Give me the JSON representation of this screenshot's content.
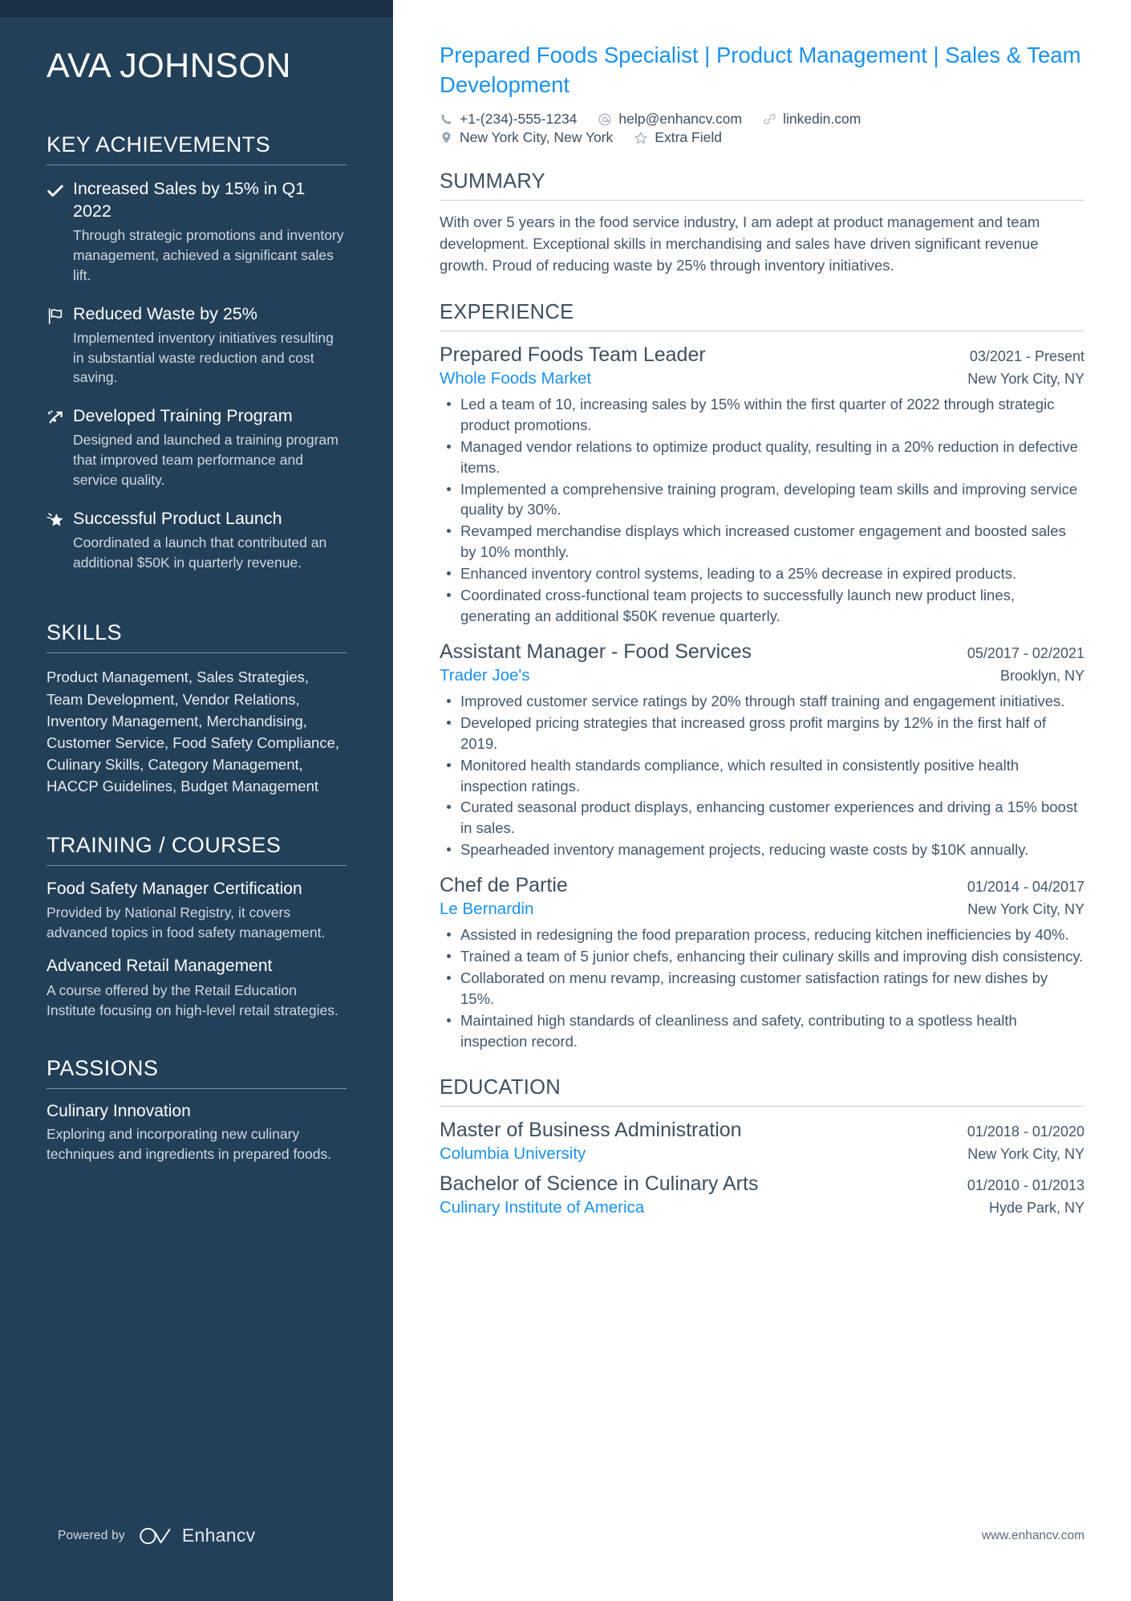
{
  "sidebar": {
    "name": "AVA JOHNSON",
    "key_achievements": {
      "heading": "KEY ACHIEVEMENTS",
      "items": [
        {
          "icon": "check-icon",
          "title": "Increased Sales by 15% in Q1 2022",
          "description": "Through strategic promotions and inventory management, achieved a significant sales lift."
        },
        {
          "icon": "flag-icon",
          "title": "Reduced Waste by 25%",
          "description": "Implemented inventory initiatives resulting in substantial waste reduction and cost saving."
        },
        {
          "icon": "rocket-arrow-icon",
          "title": "Developed Training Program",
          "description": "Designed and launched a training program that improved team performance and service quality."
        },
        {
          "icon": "shooting-star-icon",
          "title": "Successful Product Launch",
          "description": "Coordinated a launch that contributed an additional $50K in quarterly revenue."
        }
      ]
    },
    "skills": {
      "heading": "SKILLS",
      "text": "Product Management, Sales Strategies, Team Development, Vendor Relations, Inventory Management, Merchandising, Customer Service, Food Safety Compliance, Culinary Skills, Category Management, HACCP Guidelines, Budget Management"
    },
    "training": {
      "heading": "TRAINING / COURSES",
      "items": [
        {
          "title": "Food Safety Manager Certification",
          "description": "Provided by National Registry, it covers advanced topics in food safety management."
        },
        {
          "title": "Advanced Retail Management",
          "description": "A course offered by the Retail Education Institute focusing on high-level retail strategies."
        }
      ]
    },
    "passions": {
      "heading": "PASSIONS",
      "items": [
        {
          "title": "Culinary Innovation",
          "description": "Exploring and incorporating new culinary techniques and ingredients in prepared foods."
        }
      ]
    },
    "powered_by": {
      "label": "Powered by",
      "brand": "Enhancv"
    }
  },
  "main": {
    "headline": "Prepared Foods Specialist | Product Management | Sales & Team Development",
    "contacts": [
      {
        "icon": "phone-icon",
        "value": "+1-(234)-555-1234"
      },
      {
        "icon": "at-icon",
        "value": "help@enhancv.com"
      },
      {
        "icon": "link-icon",
        "value": "linkedin.com"
      },
      {
        "icon": "location-pin-icon",
        "value": "New York City, New York"
      },
      {
        "icon": "star-outline-icon",
        "value": "Extra Field"
      }
    ],
    "summary": {
      "heading": "SUMMARY",
      "text": "With over 5 years in the food service industry, I am adept at product management and team development. Exceptional skills in merchandising and sales have driven significant revenue growth. Proud of reducing waste by 25% through inventory initiatives."
    },
    "experience": {
      "heading": "EXPERIENCE",
      "entries": [
        {
          "title": "Prepared Foods Team Leader",
          "date": "03/2021 - Present",
          "org": "Whole Foods Market",
          "location": "New York City, NY",
          "bullets": [
            "Led a team of 10, increasing sales by 15% within the first quarter of 2022 through strategic product promotions.",
            "Managed vendor relations to optimize product quality, resulting in a 20% reduction in defective items.",
            "Implemented a comprehensive training program, developing team skills and improving service quality by 30%.",
            "Revamped merchandise displays which increased customer engagement and boosted sales by 10% monthly.",
            "Enhanced inventory control systems, leading to a 25% decrease in expired products.",
            "Coordinated cross-functional team projects to successfully launch new product lines, generating an additional $50K revenue quarterly."
          ]
        },
        {
          "title": "Assistant Manager - Food Services",
          "date": "05/2017 - 02/2021",
          "org": "Trader Joe's",
          "location": "Brooklyn, NY",
          "bullets": [
            "Improved customer service ratings by 20% through staff training and engagement initiatives.",
            "Developed pricing strategies that increased gross profit margins by 12% in the first half of 2019.",
            "Monitored health standards compliance, which resulted in consistently positive health inspection ratings.",
            "Curated seasonal product displays, enhancing customer experiences and driving a 15% boost in sales.",
            "Spearheaded inventory management projects, reducing waste costs by $10K annually."
          ]
        },
        {
          "title": "Chef de Partie",
          "date": "01/2014 - 04/2017",
          "org": "Le Bernardin",
          "location": "New York City, NY",
          "bullets": [
            "Assisted in redesigning the food preparation process, reducing kitchen inefficiencies by 40%.",
            "Trained a team of 5 junior chefs, enhancing their culinary skills and improving dish consistency.",
            "Collaborated on menu revamp, increasing customer satisfaction ratings for new dishes by 15%.",
            "Maintained high standards of cleanliness and safety, contributing to a spotless health inspection record."
          ]
        }
      ]
    },
    "education": {
      "heading": "EDUCATION",
      "entries": [
        {
          "title": "Master of Business Administration",
          "date": "01/2018 - 01/2020",
          "org": "Columbia University",
          "location": "New York City, NY"
        },
        {
          "title": "Bachelor of Science in Culinary Arts",
          "date": "01/2010 - 01/2013",
          "org": "Culinary Institute of America",
          "location": "Hyde Park, NY"
        }
      ]
    },
    "website": "www.enhancv.com"
  },
  "colors": {
    "sidebar_bg": "#234059",
    "accent_blue": "#1a91f0",
    "body_text": "#43566a"
  }
}
